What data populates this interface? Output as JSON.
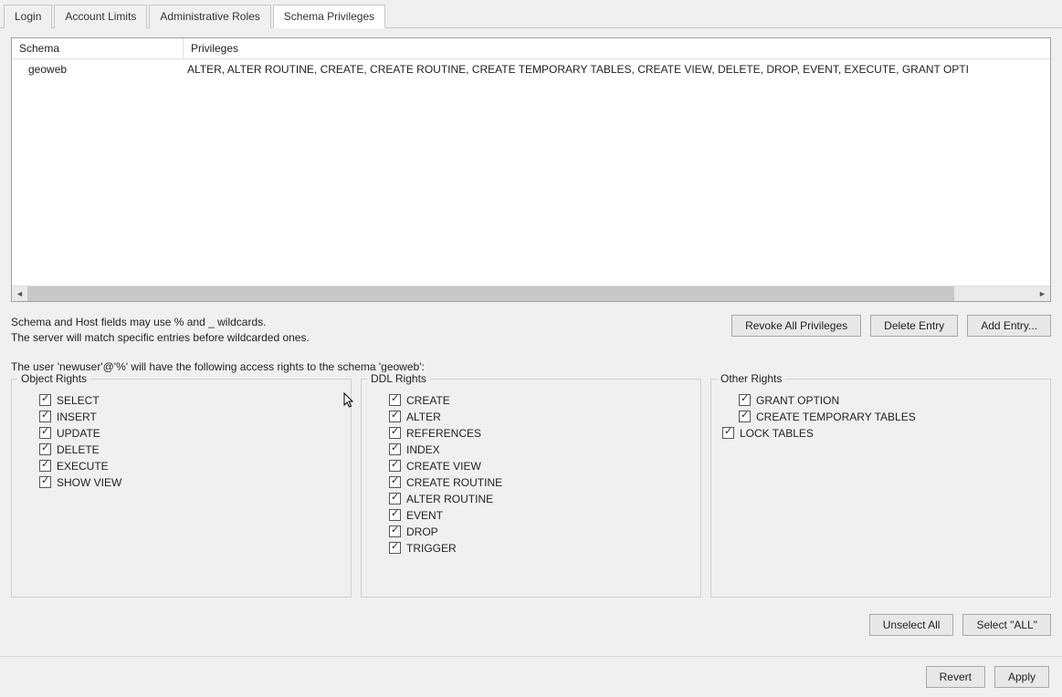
{
  "tabs": [
    {
      "label": "Login",
      "active": false
    },
    {
      "label": "Account Limits",
      "active": false
    },
    {
      "label": "Administrative Roles",
      "active": false
    },
    {
      "label": "Schema Privileges",
      "active": true
    }
  ],
  "schema_table": {
    "headers": {
      "schema": "Schema",
      "privileges": "Privileges"
    },
    "rows": [
      {
        "schema": "geoweb",
        "privileges": "ALTER, ALTER ROUTINE, CREATE, CREATE ROUTINE, CREATE TEMPORARY TABLES, CREATE VIEW, DELETE, DROP, EVENT, EXECUTE, GRANT OPTI"
      }
    ]
  },
  "hints": {
    "line1": "Schema and Host fields may use % and _ wildcards.",
    "line2": "The server will match specific entries before wildcarded ones."
  },
  "entry_buttons": {
    "revoke": "Revoke All Privileges",
    "delete": "Delete Entry",
    "add": "Add Entry..."
  },
  "access_line": "The user 'newuser'@'%' will have the following access rights to the schema 'geoweb':",
  "rights": {
    "object": {
      "title": "Object Rights",
      "items": [
        {
          "label": "SELECT",
          "checked": true
        },
        {
          "label": "INSERT",
          "checked": true
        },
        {
          "label": "UPDATE",
          "checked": true
        },
        {
          "label": "DELETE",
          "checked": true
        },
        {
          "label": "EXECUTE",
          "checked": true
        },
        {
          "label": "SHOW VIEW",
          "checked": true
        }
      ]
    },
    "ddl": {
      "title": "DDL Rights",
      "items": [
        {
          "label": "CREATE",
          "checked": true
        },
        {
          "label": "ALTER",
          "checked": true
        },
        {
          "label": "REFERENCES",
          "checked": true
        },
        {
          "label": "INDEX",
          "checked": true
        },
        {
          "label": "CREATE VIEW",
          "checked": true
        },
        {
          "label": "CREATE ROUTINE",
          "checked": true
        },
        {
          "label": "ALTER ROUTINE",
          "checked": true
        },
        {
          "label": "EVENT",
          "checked": true
        },
        {
          "label": "DROP",
          "checked": true
        },
        {
          "label": "TRIGGER",
          "checked": true
        }
      ]
    },
    "other": {
      "title": "Other Rights",
      "items": [
        {
          "label": "GRANT OPTION",
          "checked": true,
          "indent": true
        },
        {
          "label": "CREATE TEMPORARY TABLES",
          "checked": true,
          "indent": true
        },
        {
          "label": "LOCK TABLES",
          "checked": true,
          "indent": false
        }
      ]
    }
  },
  "select_buttons": {
    "unselect": "Unselect All",
    "select": "Select \"ALL\""
  },
  "footer_buttons": {
    "revert": "Revert",
    "apply": "Apply"
  }
}
